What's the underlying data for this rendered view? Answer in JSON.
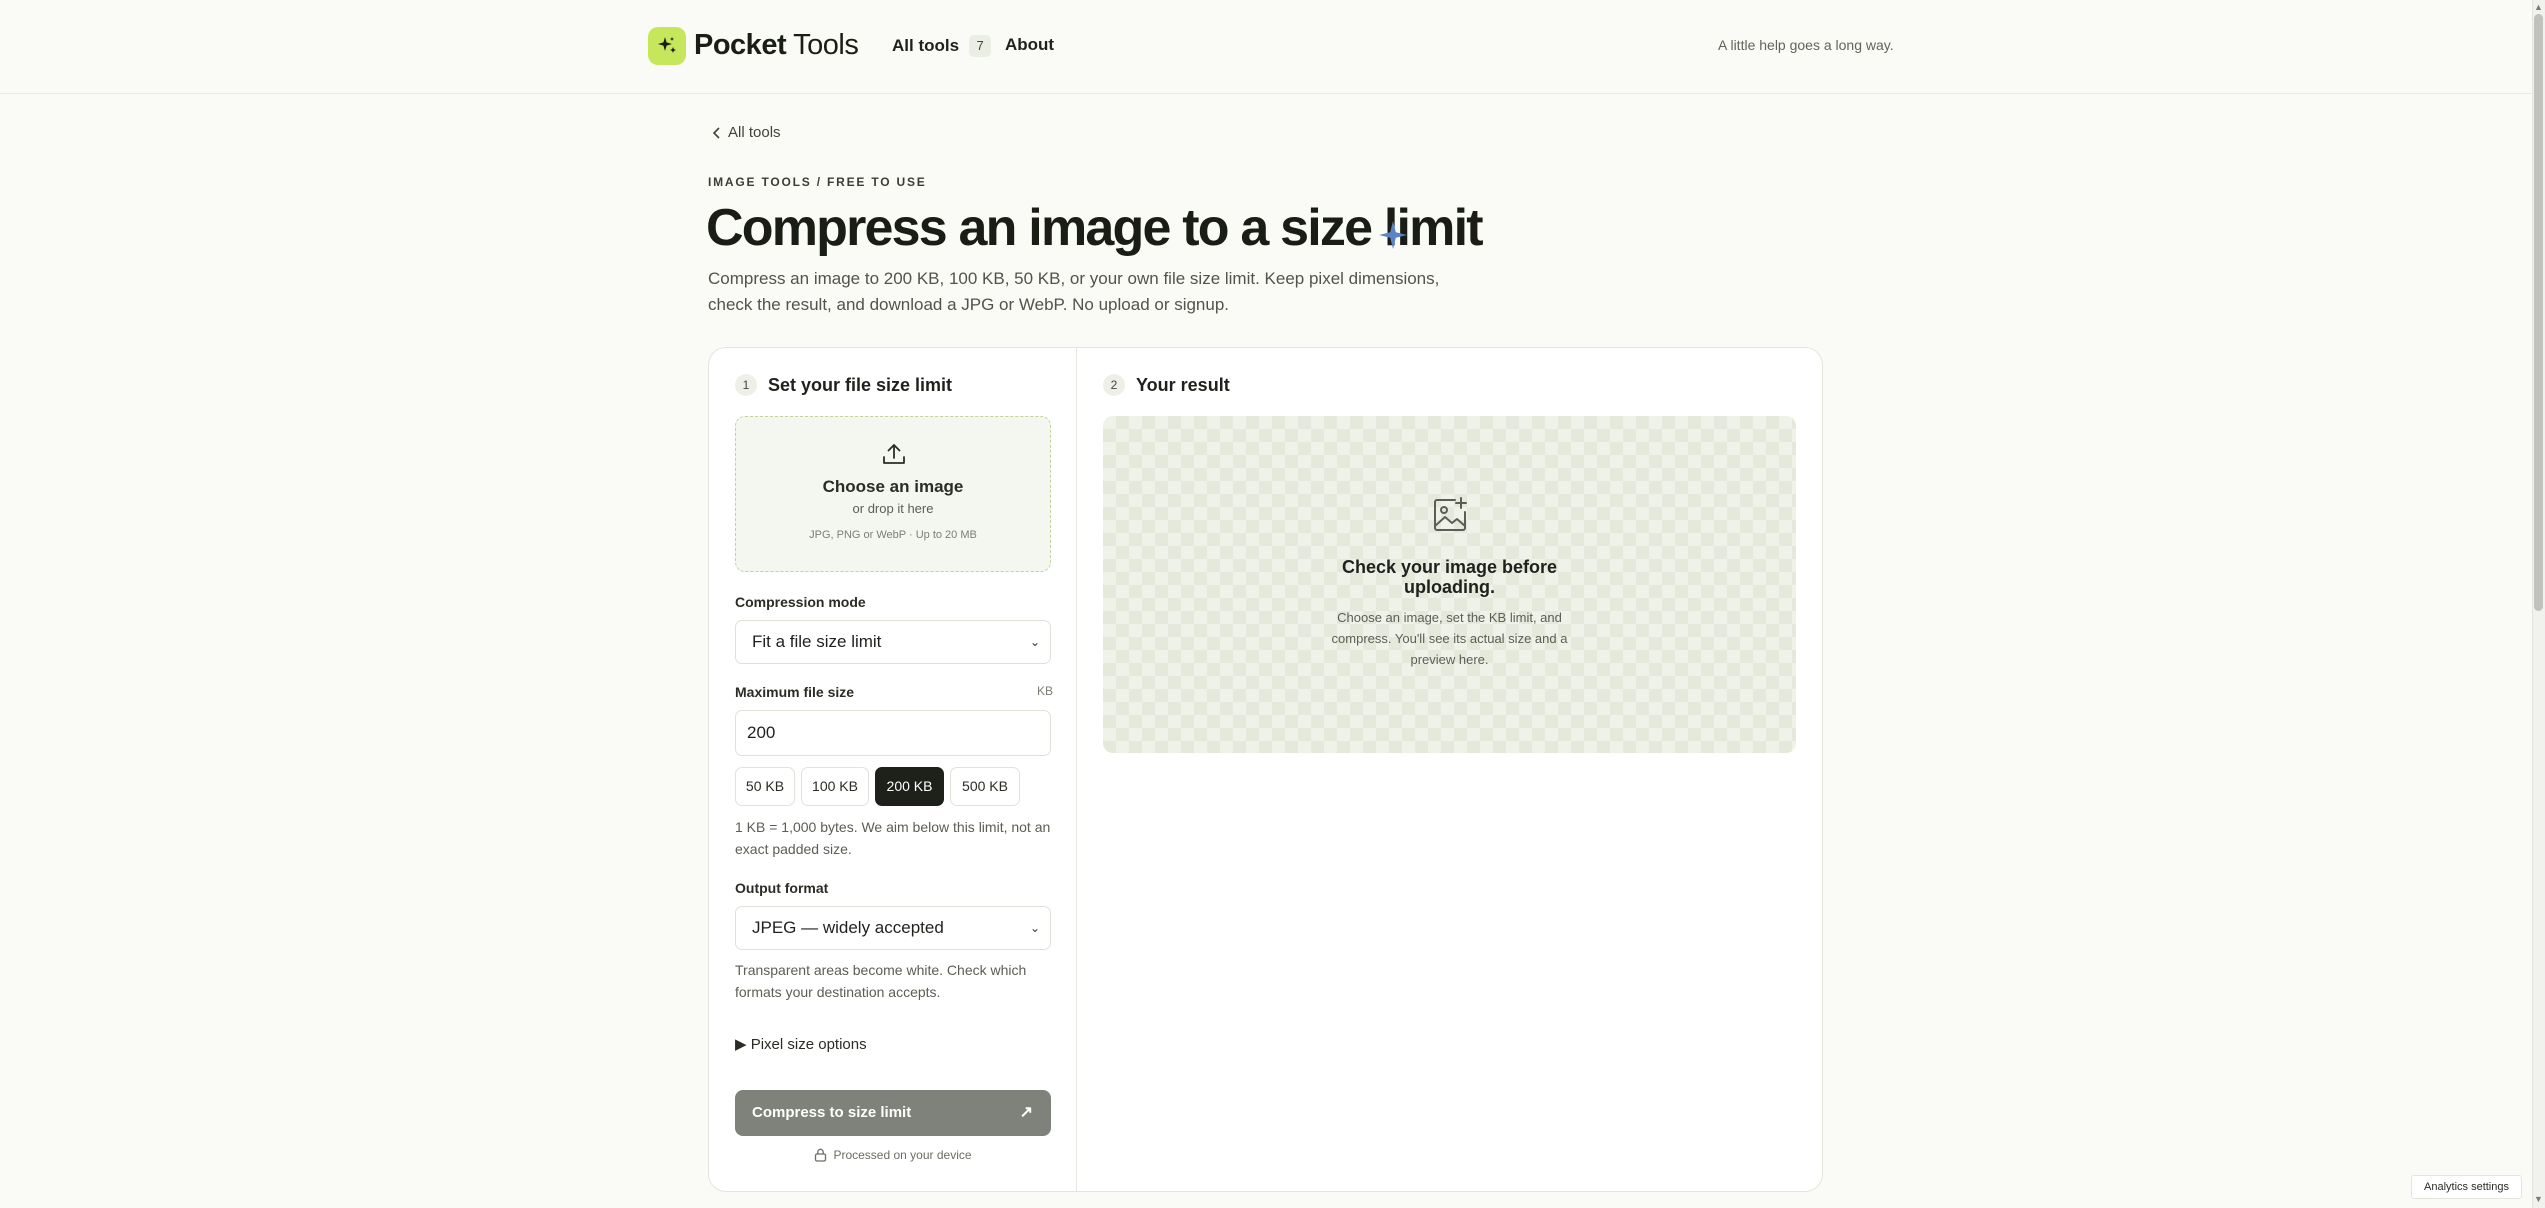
{
  "header": {
    "brand": "Pocket Tools",
    "brand_bold": "Pocket",
    "brand_rest": " Tools",
    "nav_all_tools": "All tools",
    "nav_all_tools_count": "7",
    "nav_about": "About",
    "tagline": "A little help goes a long way."
  },
  "breadcrumb": {
    "back_label": "All tools",
    "eyebrow": "IMAGE TOOLS / FREE TO USE"
  },
  "page": {
    "title": "Compress an image to a size limit",
    "description": "Compress an image to 200 KB, 100 KB, 50 KB, or your own file size limit. Keep pixel dimensions, check the result, and download a JPG or WebP. No upload or signup."
  },
  "settings": {
    "step_number": "1",
    "step_title": "Set your file size limit",
    "dropzone": {
      "title": "Choose an image",
      "subtitle": "or drop it here",
      "note": "JPG, PNG or WebP · Up to 20 MB"
    },
    "compression_mode_label": "Compression mode",
    "compression_mode_value": "Fit a file size limit",
    "max_size_label": "Maximum file size",
    "max_size_unit": "KB",
    "max_size_value": "200",
    "presets": [
      "50 KB",
      "100 KB",
      "200 KB",
      "500 KB"
    ],
    "active_preset": "200 KB",
    "kb_hint": "1 KB = 1,000 bytes. We aim below this limit, not an exact padded size.",
    "output_format_label": "Output format",
    "output_format_value": "JPEG — widely accepted",
    "format_hint": "Transparent areas become white. Check which formats your destination accepts.",
    "pixel_options_label": "Pixel size options",
    "cta_label": "Compress to size limit",
    "device_note": "Processed on your device"
  },
  "result": {
    "step_number": "2",
    "step_title": "Your result",
    "empty_title": "Check your image before uploading.",
    "empty_text": "Choose an image, set the KB limit, and compress. You'll see its actual size and a preview here."
  },
  "footer": {
    "analytics_button": "Analytics settings"
  },
  "colors": {
    "accent": "#c6e75c",
    "cta_disabled": "#7f827a",
    "active_chip": "#1d211a",
    "sparkle": "#5b83c4"
  },
  "icons": {
    "logo": "sparkle-logo-icon",
    "back": "chevron-left-icon",
    "upload": "upload-icon",
    "image_placeholder": "image-add-icon",
    "lock": "lock-icon",
    "arrow": "arrow-up-right-icon"
  }
}
